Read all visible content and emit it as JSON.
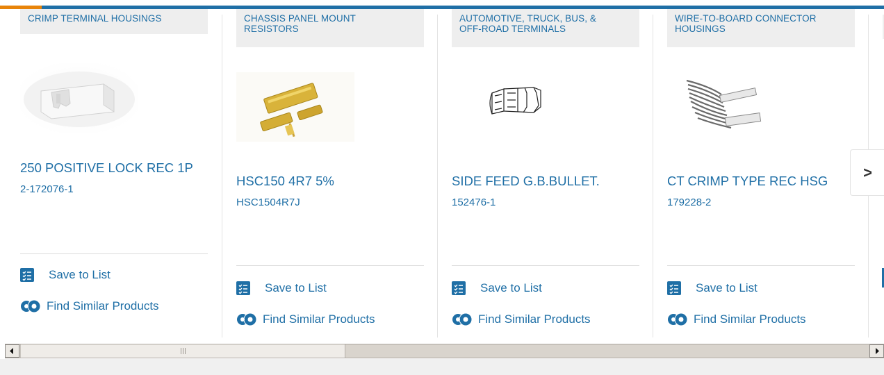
{
  "colors": {
    "brand_blue": "#1f6fa6",
    "accent_orange": "#e8840a",
    "category_bg": "#eeeeee"
  },
  "cards": [
    {
      "category": [
        "CRIMP TERMINAL HOUSINGS"
      ],
      "title": "250 POSITIVE LOCK REC 1P",
      "part_number": "2-172076-1",
      "save_label": "Save to List",
      "similar_label": "Find Similar Products",
      "image": "white-plastic-housing-image"
    },
    {
      "category": [
        "CHASSIS PANEL MOUNT",
        "RESISTORS"
      ],
      "title": "HSC150 4R7 5%",
      "part_number": "HSC1504R7J",
      "save_label": "Save to List",
      "similar_label": "Find Similar Products",
      "image": "gold-resistors-image"
    },
    {
      "category": [
        "AUTOMOTIVE, TRUCK, BUS, &",
        "OFF-ROAD TERMINALS"
      ],
      "title": "SIDE FEED G.B.BULLET.",
      "part_number": "152476-1",
      "save_label": "Save to List",
      "similar_label": "Find Similar Products",
      "image": "bullet-terminal-drawing"
    },
    {
      "category": [
        "WIRE-TO-BOARD CONNECTOR",
        "HOUSINGS"
      ],
      "title": "CT CRIMP TYPE REC HSG",
      "part_number": "179228-2",
      "save_label": "Save to List",
      "similar_label": "Find Similar Products",
      "image": "ribbon-cable-image"
    }
  ],
  "next_button": {
    "icon": "chevron-right-icon",
    "label": ">"
  }
}
